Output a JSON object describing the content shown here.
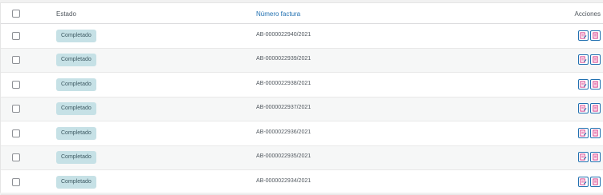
{
  "header": {
    "estado": "Estado",
    "numero_factura": "Número factura",
    "acciones": "Acciones"
  },
  "rows": [
    {
      "status": "Completado",
      "invoice": "AB-0000022940/2021"
    },
    {
      "status": "Completado",
      "invoice": "AB-0000022939/2021"
    },
    {
      "status": "Completado",
      "invoice": "AB-0000022938/2021"
    },
    {
      "status": "Completado",
      "invoice": "AB-0000022937/2021"
    },
    {
      "status": "Completado",
      "invoice": "AB-0000022936/2021"
    },
    {
      "status": "Completado",
      "invoice": "AB-0000022935/2021"
    },
    {
      "status": "Completado",
      "invoice": "AB-0000022934/2021"
    }
  ],
  "icons": {
    "action_1": "edit-document-icon",
    "action_2": "pdf-document-icon"
  },
  "colors": {
    "link": "#2271b1",
    "badge_bg": "#c6e1e6",
    "icon_accent": "#d63384"
  }
}
